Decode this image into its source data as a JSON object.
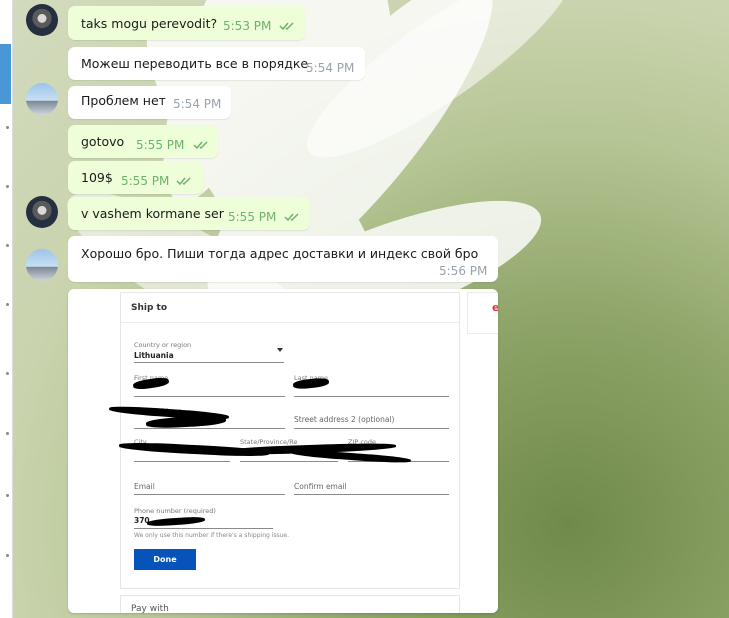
{
  "messages": [
    {
      "text": "taks mogu perevodit?",
      "time": "5:53 PM"
    },
    {
      "text": "Можеш переводить все в порядке",
      "time": "5:54 PM"
    },
    {
      "text": "Проблем нет",
      "time": "5:54 PM"
    },
    {
      "text": "gotovo",
      "time": "5:55 PM"
    },
    {
      "text": "109$",
      "time": "5:55 PM"
    },
    {
      "text": "v vashem kormane ser",
      "time": "5:55 PM"
    },
    {
      "text": "Хорошо бро. Пиши тогда адрес доставки и индекс свой бро",
      "time": "5:56 PM"
    }
  ],
  "shipping_form": {
    "title": "Ship to",
    "country_label": "Country or region",
    "country_value": "Lithuania",
    "first_name_label": "First name",
    "last_name_label": "Last name",
    "street_label": "Street address",
    "street2_placeholder": "Street address 2 (optional)",
    "city_label": "City",
    "state_label": "State/Province/Re",
    "zip_label": "ZIP code",
    "email_placeholder": "Email",
    "confirm_email_placeholder": "Confirm email",
    "phone_label": "Phone number (required)",
    "phone_value_prefix": "370",
    "phone_note": "We only use this number if there's a shipping issue.",
    "done_label": "Done",
    "pay_with_label": "Pay with",
    "side_letter": "e"
  },
  "colors": {
    "outgoing_bubble": "#eefed9",
    "incoming_bubble": "#ffffff",
    "outgoing_time": "#6fb26c",
    "incoming_time": "#9aa2ab",
    "done_button": "#0654ba",
    "sidebar_active": "#4a97d6"
  },
  "icons": {
    "read_receipt": "double-check-icon",
    "dropdown": "chevron-down-icon"
  }
}
